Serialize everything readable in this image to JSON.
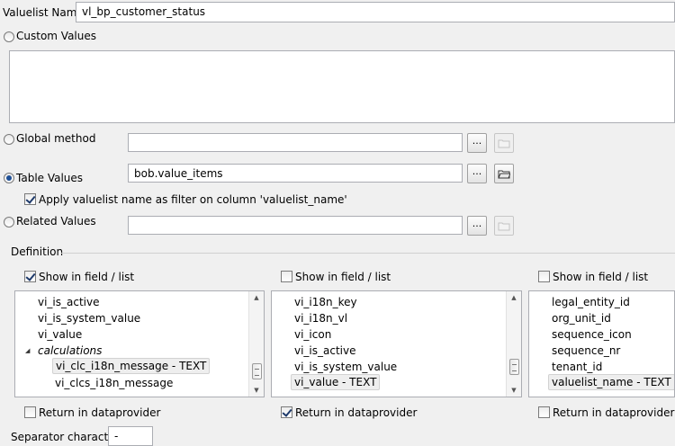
{
  "valuelist_name": {
    "label": "Valuelist Name",
    "value": "vl_bp_customer_status"
  },
  "custom_values": {
    "label": "Custom Values",
    "selected": false,
    "text": ""
  },
  "global_method": {
    "label": "Global method",
    "selected": false,
    "value": "",
    "browse": "..."
  },
  "table_values": {
    "label": "Table Values",
    "selected": true,
    "value": "bob.value_items",
    "browse": "...",
    "apply_filter": {
      "label": "Apply valuelist name as filter on column 'valuelist_name'",
      "checked": true
    }
  },
  "related_values": {
    "label": "Related Values",
    "selected": false,
    "value": "",
    "browse": "..."
  },
  "definition": {
    "label": "Definition",
    "columns": [
      {
        "show_label": "Show in field / list",
        "show_checked": true,
        "return_label": "Return in dataprovider",
        "return_checked": false,
        "items": [
          {
            "text": "vi_is_active"
          },
          {
            "text": "vi_is_system_value"
          },
          {
            "text": "vi_value"
          },
          {
            "text": "calculations",
            "group": true
          },
          {
            "text": "vi_clc_i18n_message - TEXT",
            "selected": true,
            "indent": true
          },
          {
            "text": "vi_clcs_i18n_message",
            "indent": true
          }
        ]
      },
      {
        "show_label": "Show in field / list",
        "show_checked": false,
        "return_label": "Return in dataprovider",
        "return_checked": true,
        "items": [
          {
            "text": "vi_i18n_key"
          },
          {
            "text": "vi_i18n_vl"
          },
          {
            "text": "vi_icon"
          },
          {
            "text": "vi_is_active"
          },
          {
            "text": "vi_is_system_value"
          },
          {
            "text": "vi_value - TEXT",
            "selected": true
          }
        ]
      },
      {
        "show_label": "Show in field / list",
        "show_checked": false,
        "return_label": "Return in dataprovider",
        "return_checked": false,
        "items": [
          {
            "text": "legal_entity_id"
          },
          {
            "text": "org_unit_id"
          },
          {
            "text": "sequence_icon"
          },
          {
            "text": "sequence_nr"
          },
          {
            "text": "tenant_id"
          },
          {
            "text": "valuelist_name - TEXT",
            "selected": true
          }
        ]
      }
    ]
  },
  "separator": {
    "label": "Separator character",
    "value": "-"
  }
}
